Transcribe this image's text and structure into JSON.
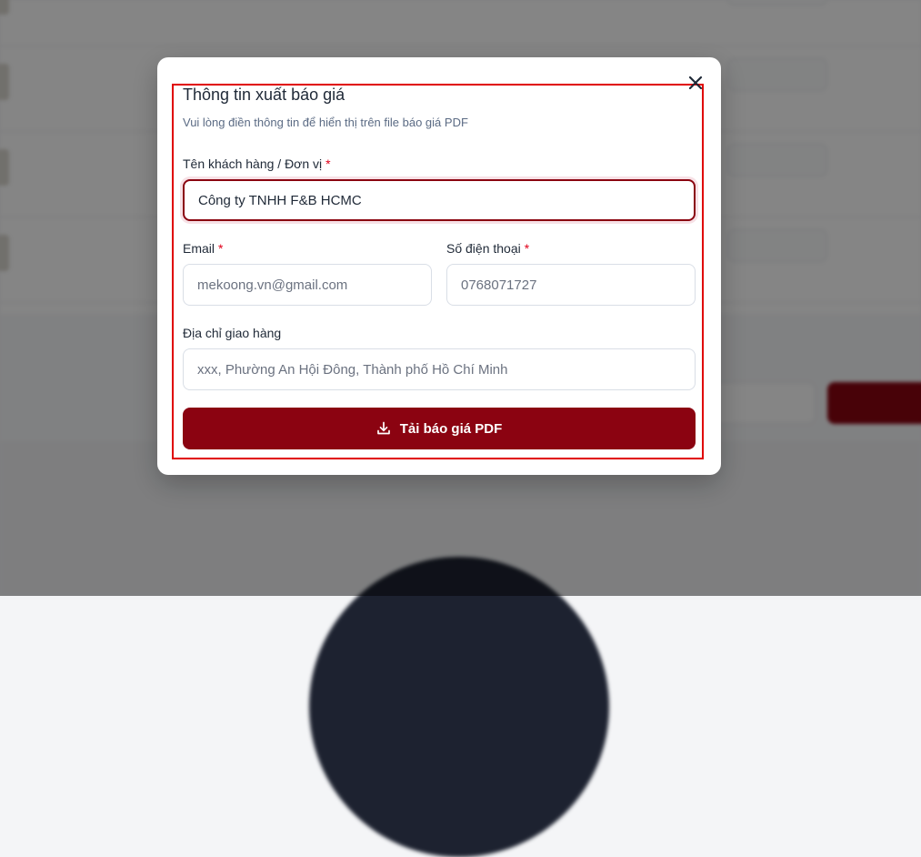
{
  "modal": {
    "title": "Thông tin xuất báo giá",
    "subtitle": "Vui lòng điền thông tin để hiển thị trên file báo giá PDF",
    "close_icon": "close-icon",
    "customer": {
      "label": "Tên khách hàng / Đơn vị",
      "required_mark": "*",
      "value": "Công ty TNHH F&B HCMC"
    },
    "email": {
      "label": "Email",
      "required_mark": "*",
      "placeholder": "mekoong.vn@gmail.com"
    },
    "phone": {
      "label": "Số điện thoại",
      "required_mark": "*",
      "placeholder": "0768071727"
    },
    "address": {
      "label": "Địa chỉ giao hàng",
      "placeholder": "xxx, Phường An Hội Đông, Thành phố Hồ Chí Minh"
    },
    "submit": {
      "icon": "download-icon",
      "label": "Tải báo giá PDF"
    }
  },
  "colors": {
    "accent": "#8b0311",
    "required": "#e0001a",
    "highlight_box": "#e00000",
    "overlay": "rgba(0,0,0,0.48)"
  }
}
